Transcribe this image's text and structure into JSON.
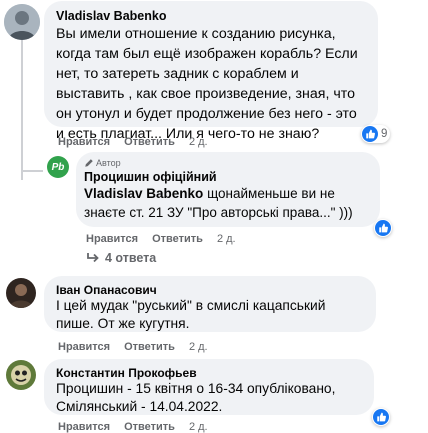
{
  "comments": [
    {
      "author": "Vladislav Babenko",
      "text": "Вы имели отношение к созданию рисунка, когда там был ещё изображен корабль? Если нет, то затереть задник с кораблем и выставить , как свое произведение, зная, что он утонул и будет продолжение без него - это и есть плагиат... Или я чего-то не знаю?",
      "actions": {
        "like": "Нравится",
        "reply": "Ответить",
        "time": "2 д."
      },
      "reactions": {
        "icon": "like-icon",
        "count": "9"
      }
    },
    {
      "badge": "Автор",
      "author": "Процишин офіційний",
      "mention": "Vladislav Babenko",
      "text": " щонайменьше ви не знаєте ст. 21 ЗУ \"Про авторські права...\" )))",
      "actions": {
        "like": "Нравится",
        "reply": "Ответить",
        "time": "2 д."
      },
      "reactions": {
        "icon": "like-icon"
      },
      "replies_label": "4 ответа",
      "avatar_initials": "Pb"
    },
    {
      "author": "Іван Опанасович",
      "text": "І цей мудак \"руський\" в смислі кацапський пише. От же кугутня.",
      "actions": {
        "like": "Нравится",
        "reply": "Ответить",
        "time": "2 д."
      }
    },
    {
      "author": "Константин Прокофьев",
      "text": "Процишин - 15 квітня о 16-34 опубліковано, Смілянський - 14.04.2022.",
      "actions": {
        "like": "Нравится",
        "reply": "Ответить",
        "time": "2 д."
      },
      "reactions": {
        "icon": "like-icon"
      }
    }
  ],
  "colors": {
    "bubble": "#f0f2f5",
    "like_blue": "#1877f2",
    "author_green": "#31a24c",
    "secondary_text": "#65676b"
  }
}
